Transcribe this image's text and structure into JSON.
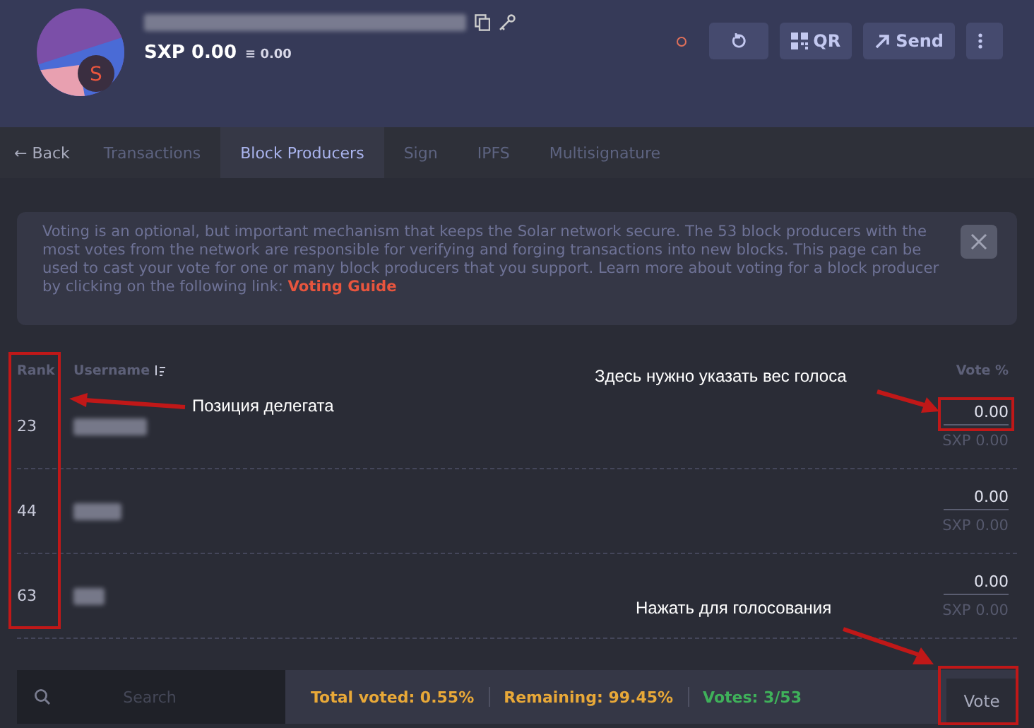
{
  "wallet": {
    "balance": "SXP 0.00",
    "fiat": "≡ 0.00",
    "avatar_letter": "S"
  },
  "header_buttons": [
    {
      "kind": "refresh"
    },
    {
      "kind": "qr",
      "label": "QR"
    },
    {
      "kind": "send",
      "label": "Send"
    },
    {
      "kind": "more"
    }
  ],
  "tabs": [
    {
      "label": "← Back",
      "selected": false
    },
    {
      "label": "Transactions",
      "selected": false
    },
    {
      "label": "Block Producers",
      "selected": true
    },
    {
      "label": "Sign",
      "selected": false
    },
    {
      "label": "IPFS",
      "selected": false
    },
    {
      "label": "Multisignature",
      "selected": false
    }
  ],
  "notice": {
    "text": "Voting is an optional, but important mechanism that keeps the Solar network secure. The 53 block producers with the most votes from the network are responsible for verifying and forging transactions into new blocks. This page can be used to cast your vote for one or many block producers that you support. Learn more about voting for a block producer by clicking on the following link: ",
    "link": "Voting Guide"
  },
  "table": {
    "columns": [
      "Rank",
      "Username",
      "Vote %"
    ],
    "rows": [
      {
        "rank": "23",
        "vote": "0.00",
        "amount": "SXP 0.00"
      },
      {
        "rank": "44",
        "vote": "0.00",
        "amount": "SXP 0.00"
      },
      {
        "rank": "63",
        "vote": "0.00",
        "amount": "SXP 0.00"
      }
    ]
  },
  "footer": {
    "search_placeholder": "Search",
    "total_voted": "Total voted: 0.55%",
    "remaining": "Remaining: 99.45%",
    "votes": "Votes: 3/53",
    "vote_button": "Vote"
  },
  "annotations": [
    "Позиция делегата",
    "Здесь нужно указать вес голоса",
    "Нажать для голосования"
  ]
}
